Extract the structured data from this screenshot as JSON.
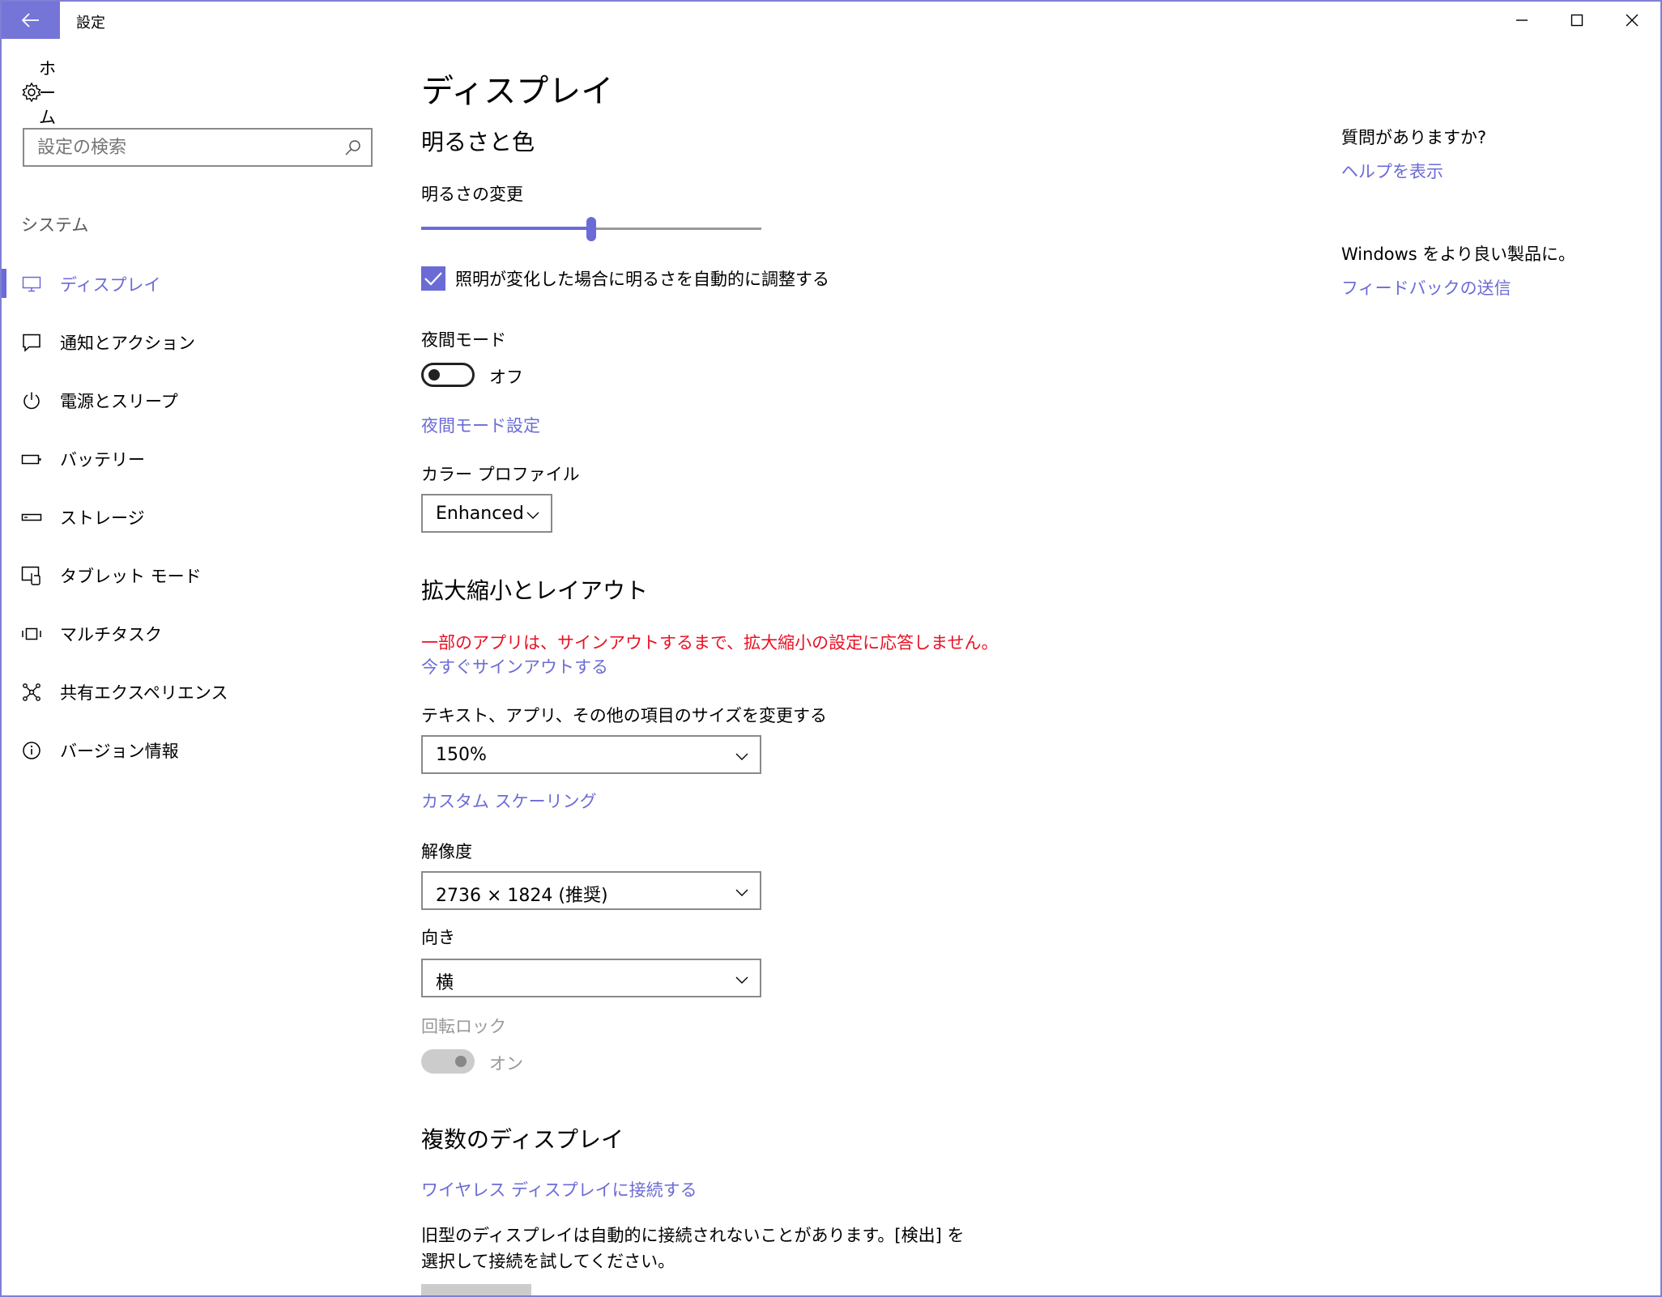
{
  "window": {
    "title": "設定"
  },
  "sidebar": {
    "home_label": "ホーム",
    "search_placeholder": "設定の検索",
    "section_label": "システム",
    "items": [
      {
        "label": "ディスプレイ",
        "icon": "monitor-icon",
        "active": true
      },
      {
        "label": "通知とアクション",
        "icon": "message-icon",
        "active": false
      },
      {
        "label": "電源とスリープ",
        "icon": "power-icon",
        "active": false
      },
      {
        "label": "バッテリー",
        "icon": "battery-icon",
        "active": false
      },
      {
        "label": "ストレージ",
        "icon": "storage-icon",
        "active": false
      },
      {
        "label": "タブレット モード",
        "icon": "tablet-icon",
        "active": false
      },
      {
        "label": "マルチタスク",
        "icon": "multitask-icon",
        "active": false
      },
      {
        "label": "共有エクスペリエンス",
        "icon": "share-icon",
        "active": false
      },
      {
        "label": "バージョン情報",
        "icon": "info-icon",
        "active": false
      }
    ]
  },
  "main": {
    "page_title": "ディスプレイ",
    "brightness": {
      "heading": "明るさと色",
      "slider_label": "明るさの変更",
      "level": 0.5,
      "auto_label": "照明が変化した場合に明るさを自動的に調整する",
      "auto_checked": true
    },
    "night_mode": {
      "label": "夜間モード",
      "state": "オフ",
      "settings_link": "夜間モード設定"
    },
    "color_profile": {
      "label": "カラー プロファイル",
      "value": "Enhanced"
    },
    "scaling": {
      "heading": "拡大縮小とレイアウト",
      "warning": "一部のアプリは、サインアウトするまで、拡大縮小の設定に応答しません。",
      "signout_link": "今すぐサインアウトする",
      "size_label": "テキスト、アプリ、その他の項目のサイズを変更する",
      "size_value": "150%",
      "custom_link": "カスタム スケーリング",
      "resolution_label": "解像度",
      "resolution_value": "2736 × 1824 (推奨)",
      "orientation_label": "向き",
      "orientation_value": "横",
      "rotation_lock_label": "回転ロック",
      "rotation_lock_state": "オン"
    },
    "multi_display": {
      "heading": "複数のディスプレイ",
      "wireless_link": "ワイヤレス ディスプレイに接続する",
      "description": "旧型のディスプレイは自動的に接続されないことがあります。[検出] を選択して接続を試してください。"
    }
  },
  "right_panel": {
    "question": "質問がありますか?",
    "help_link": "ヘルプを表示",
    "feedback_text": "Windows をより良い製品に。",
    "feedback_link": "フィードバックの送信"
  },
  "colors": {
    "accent": "#6b6bd6",
    "warning": "#e81123"
  }
}
